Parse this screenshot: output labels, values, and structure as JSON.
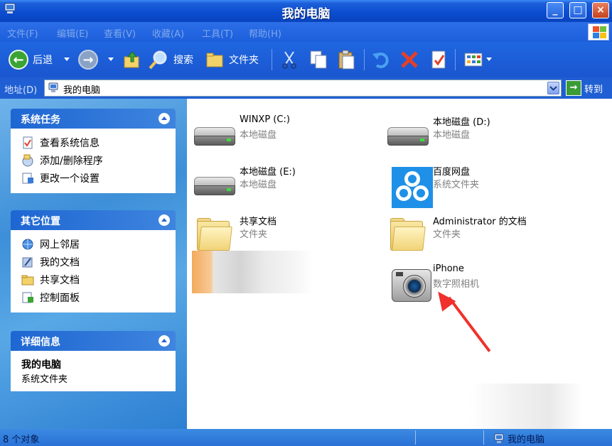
{
  "window": {
    "title": "我的电脑"
  },
  "menu": [
    "文件(F)",
    "编辑(E)",
    "查看(V)",
    "收藏(A)",
    "工具(T)",
    "帮助(H)"
  ],
  "toolbar": {
    "back": "后退",
    "search": "搜索",
    "folders": "文件夹"
  },
  "address": {
    "label": "地址(D)",
    "value": "我的电脑",
    "go": "转到"
  },
  "tasks": {
    "title": "系统任务",
    "items": [
      "查看系统信息",
      "添加/删除程序",
      "更改一个设置"
    ]
  },
  "places": {
    "title": "其它位置",
    "items": [
      "网上邻居",
      "我的文档",
      "共享文档",
      "控制面板"
    ]
  },
  "details": {
    "title": "详细信息",
    "name": "我的电脑",
    "type": "系统文件夹"
  },
  "items": [
    {
      "name": "WINXP (C:)",
      "type": "本地磁盘",
      "icon": "hard-drive-icon"
    },
    {
      "name": "本地磁盘 (D:)",
      "type": "本地磁盘",
      "icon": "hard-drive-icon"
    },
    {
      "name": "本地磁盘 (E:)",
      "type": "本地磁盘",
      "icon": "hard-drive-icon"
    },
    {
      "name": "百度网盘",
      "type": "系统文件夹",
      "icon": "baidu-netdisk-icon"
    },
    {
      "name": "共享文档",
      "type": "文件夹",
      "icon": "folder-icon"
    },
    {
      "name": "Administrator 的文档",
      "type": "文件夹",
      "icon": "folder-icon"
    },
    {
      "name": "iPhone",
      "type": "数字照相机",
      "icon": "camera-icon"
    }
  ],
  "status": {
    "count": "8 个对象",
    "location": "我的电脑"
  },
  "colors": {
    "accent": "#0b4cd0",
    "annotation_arrow": "#f0302c"
  }
}
